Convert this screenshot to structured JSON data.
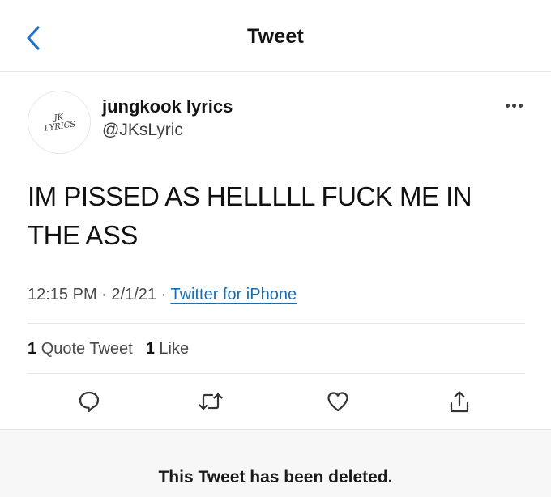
{
  "header": {
    "title": "Tweet",
    "back_icon": "chevron-left-icon"
  },
  "tweet": {
    "avatar_text": "JK LYRICS",
    "display_name": "jungkook lyrics",
    "handle": "@JKsLyric",
    "more_icon": "more-horizontal-icon",
    "text": "IM PISSED AS HELLLLL FUCK ME IN THE ASS",
    "time": "12:15 PM",
    "date": "2/1/21",
    "separator": "·",
    "source": "Twitter for iPhone",
    "stats": {
      "quote_count": "1",
      "quote_label": "Quote Tweet",
      "like_count": "1",
      "like_label": "Like"
    },
    "actions": [
      "reply-icon",
      "retweet-icon",
      "like-icon",
      "share-icon"
    ]
  },
  "footer": {
    "deleted_notice": "This Tweet has been deleted."
  },
  "colors": {
    "link": "#1a6db3",
    "back_arrow": "#2a72c4",
    "divider": "#e1e6ea"
  }
}
